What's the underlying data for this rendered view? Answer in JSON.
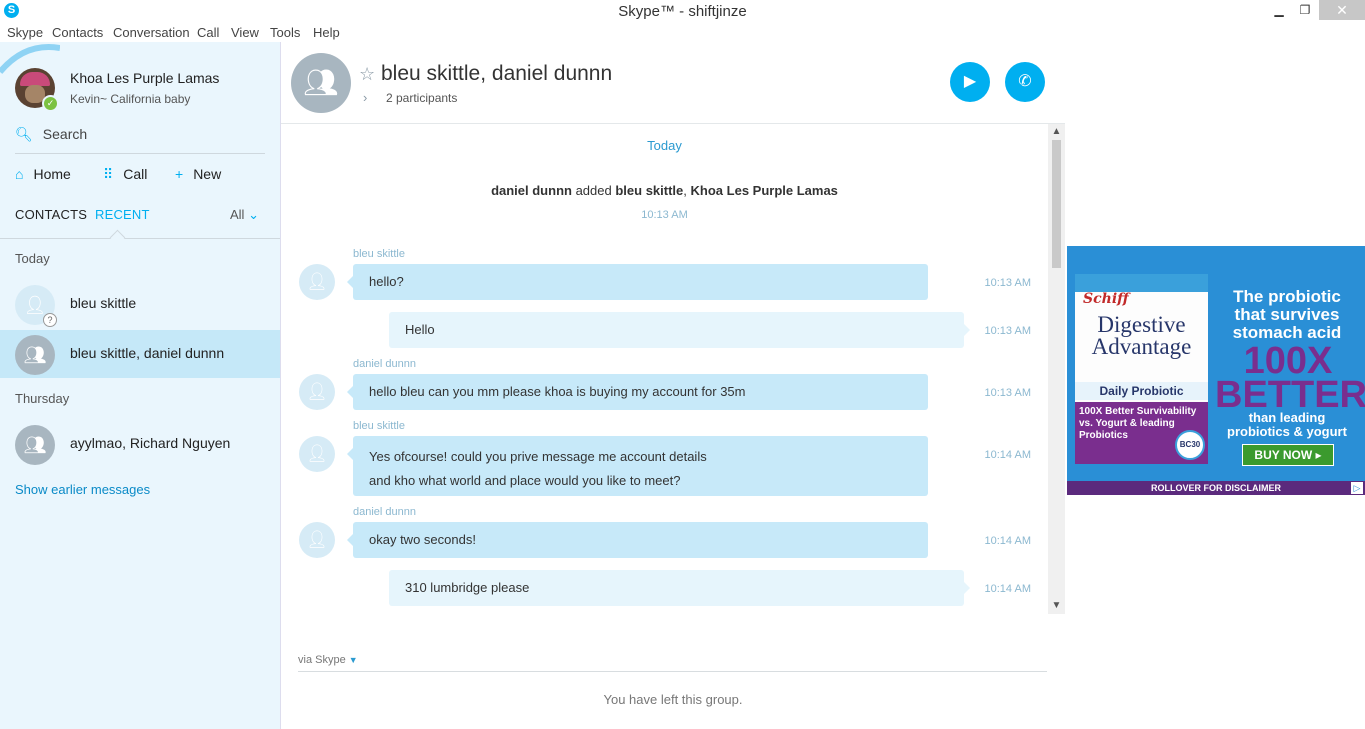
{
  "window": {
    "title": "Skype™ - shiftjinze",
    "minimize": "▁",
    "maximize": "❐",
    "close": "✕",
    "app_icon": "S"
  },
  "menu": [
    "Skype",
    "Contacts",
    "Conversation",
    "Call",
    "View",
    "Tools",
    "Help"
  ],
  "profile": {
    "name": "Khoa Les Purple Lamas",
    "mood": "Kevin~ California baby",
    "status": "online"
  },
  "search": {
    "label": "Search"
  },
  "nav": {
    "home": "Home",
    "call": "Call",
    "new": "New"
  },
  "tabs": {
    "contacts": "CONTACTS",
    "recent": "RECENT",
    "filter": "All"
  },
  "recent": {
    "groups": [
      {
        "label": "Today"
      },
      {
        "label": "Thursday"
      }
    ],
    "items": [
      {
        "name": "bleu skittle",
        "type": "person"
      },
      {
        "name": "bleu skittle, daniel dunnn",
        "type": "group",
        "selected": true
      },
      {
        "name": "ayylmao, Richard Nguyen",
        "type": "group"
      }
    ],
    "show_earlier": "Show earlier messages"
  },
  "conversation": {
    "title": "bleu skittle, daniel dunnn",
    "participants": "2 participants",
    "date_separator": "Today",
    "system_message": {
      "actor": "daniel dunnn",
      "verb": "added",
      "target1": "bleu skittle",
      "sep": ",",
      "target2": "Khoa Les Purple Lamas",
      "time": "10:13 AM"
    },
    "messages": [
      {
        "sender": "bleu skittle",
        "lines": [
          "hello?"
        ],
        "time": "10:13 AM",
        "direction": "in"
      },
      {
        "sender": "",
        "lines": [
          "Hello"
        ],
        "time": "10:13 AM",
        "direction": "out"
      },
      {
        "sender": "daniel dunnn",
        "lines": [
          "hello bleu can you mm please khoa is buying my account for 35m"
        ],
        "time": "10:13 AM",
        "direction": "in"
      },
      {
        "sender": "bleu skittle",
        "lines": [
          "Yes ofcourse! could you prive message me account details",
          "and kho what world and place would you like to meet?"
        ],
        "time": "10:14 AM",
        "direction": "in"
      },
      {
        "sender": "daniel dunnn",
        "lines": [
          "okay two seconds!"
        ],
        "time": "10:14 AM",
        "direction": "in"
      },
      {
        "sender": "",
        "lines": [
          "310 lumbridge please"
        ],
        "time": "10:14 AM",
        "direction": "out"
      }
    ],
    "via": "via Skype",
    "footer_notice": "You have left this group."
  },
  "ad": {
    "brand": "Schiff",
    "product": "Digestive Advantage",
    "daily": "Daily Probiotic",
    "survivability": "100X Better Survivability vs. Yogurt & leading Probiotics",
    "seal": "BC30",
    "headline": "The probiotic that survives stomach acid",
    "big": "100X BETTER",
    "than": "than leading probiotics & yogurt",
    "cta": "BUY NOW ▸",
    "disclaimer": "ROLLOVER FOR DISCLAIMER",
    "adchoices": "▷"
  }
}
